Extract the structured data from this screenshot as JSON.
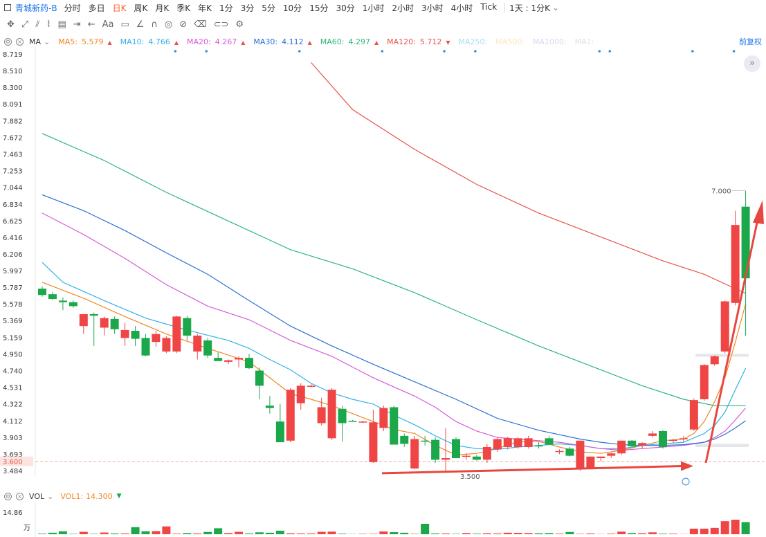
{
  "header": {
    "ticker": "青城新药-B",
    "timeframes": [
      "分时",
      "多日",
      "日K",
      "周K",
      "月K",
      "季K",
      "年K",
      "1分",
      "3分",
      "5分",
      "10分",
      "15分",
      "30分",
      "1小时",
      "2小时",
      "3小时",
      "4小时",
      "Tick"
    ],
    "active_timeframe": "日K",
    "custom_timeframe": "1天 : 1分K"
  },
  "toolbar": {
    "text_tool": "Aa"
  },
  "ma_bar": {
    "indicator": "MA",
    "items": [
      {
        "label": "MA5:",
        "value": "5.579",
        "trend": "▲",
        "color": "#f0861f"
      },
      {
        "label": "MA10:",
        "value": "4.766",
        "trend": "▲",
        "color": "#2fb1e8"
      },
      {
        "label": "MA20:",
        "value": "4.267",
        "trend": "▲",
        "color": "#d65ad8"
      },
      {
        "label": "MA30:",
        "value": "4.112",
        "trend": "▲",
        "color": "#2a6fd6"
      },
      {
        "label": "MA60:",
        "value": "4.297",
        "trend": "▲",
        "color": "#2bb67a"
      },
      {
        "label": "MA120:",
        "value": "5.712",
        "trend": "▼",
        "color": "#e8524d"
      },
      {
        "label": "MA250:",
        "value": "",
        "trend": "",
        "color": "#5ec8e8"
      },
      {
        "label": "MA500:",
        "value": "",
        "trend": "",
        "color": "#f6cf8a"
      },
      {
        "label": "MA1000:",
        "value": "",
        "trend": "",
        "color": "#b9b9e8"
      },
      {
        "label": "MA1:",
        "value": "",
        "trend": "",
        "color": "#c9c9c9"
      }
    ],
    "adjust": "前复权"
  },
  "vol_bar": {
    "indicator": "VOL",
    "item_label": "VOL1:",
    "item_value": "14.300",
    "trend": "▼"
  },
  "colors": {
    "up": "#f04545",
    "down": "#1aa84a",
    "arrow": "#e8473f"
  },
  "chart_data": {
    "type": "candlestick",
    "y_ticks": [
      "8.719",
      "8.510",
      "8.300",
      "8.091",
      "7.882",
      "7.672",
      "7.463",
      "7.253",
      "7.044",
      "6.834",
      "6.625",
      "6.416",
      "6.206",
      "5.997",
      "5.787",
      "5.578",
      "5.369",
      "5.159",
      "4.950",
      "4.740",
      "4.531",
      "4.322",
      "4.112",
      "3.903",
      "3.693",
      "3.484"
    ],
    "ylim": [
      3.484,
      8.719
    ],
    "current_price_label": "3.600",
    "annotations": [
      {
        "label": "7.000"
      },
      {
        "label": "3.500"
      }
    ],
    "candles": [
      {
        "o": 5.77,
        "h": 5.8,
        "l": 5.67,
        "c": 5.69
      },
      {
        "o": 5.7,
        "h": 5.73,
        "l": 5.63,
        "c": 5.64
      },
      {
        "o": 5.62,
        "h": 5.66,
        "l": 5.5,
        "c": 5.6
      },
      {
        "o": 5.6,
        "h": 5.62,
        "l": 5.53,
        "c": 5.55
      },
      {
        "o": 5.3,
        "h": 5.45,
        "l": 5.2,
        "c": 5.45
      },
      {
        "o": 5.45,
        "h": 5.47,
        "l": 5.05,
        "c": 5.43
      },
      {
        "o": 5.28,
        "h": 5.42,
        "l": 5.18,
        "c": 5.4
      },
      {
        "o": 5.39,
        "h": 5.42,
        "l": 5.2,
        "c": 5.26
      },
      {
        "o": 5.15,
        "h": 5.34,
        "l": 5.05,
        "c": 5.25
      },
      {
        "o": 5.24,
        "h": 5.3,
        "l": 5.05,
        "c": 5.14
      },
      {
        "o": 5.15,
        "h": 5.2,
        "l": 4.92,
        "c": 4.93
      },
      {
        "o": 5.1,
        "h": 5.24,
        "l": 5.04,
        "c": 5.2
      },
      {
        "o": 4.98,
        "h": 5.17,
        "l": 4.96,
        "c": 5.15
      },
      {
        "o": 4.98,
        "h": 5.43,
        "l": 4.96,
        "c": 5.42
      },
      {
        "o": 5.4,
        "h": 5.43,
        "l": 5.12,
        "c": 5.18
      },
      {
        "o": 4.98,
        "h": 5.2,
        "l": 4.88,
        "c": 5.18
      },
      {
        "o": 5.12,
        "h": 5.15,
        "l": 4.9,
        "c": 4.93
      },
      {
        "o": 4.9,
        "h": 4.97,
        "l": 4.86,
        "c": 4.86
      },
      {
        "o": 4.85,
        "h": 4.88,
        "l": 4.82,
        "c": 4.87
      },
      {
        "o": 4.88,
        "h": 4.92,
        "l": 4.78,
        "c": 4.9
      },
      {
        "o": 4.9,
        "h": 4.95,
        "l": 4.76,
        "c": 4.77
      },
      {
        "o": 4.74,
        "h": 4.78,
        "l": 4.38,
        "c": 4.55
      },
      {
        "o": 4.3,
        "h": 4.42,
        "l": 4.2,
        "c": 4.27
      },
      {
        "o": 4.1,
        "h": 4.32,
        "l": 3.88,
        "c": 3.84
      },
      {
        "o": 3.86,
        "h": 4.52,
        "l": 3.84,
        "c": 4.5
      },
      {
        "o": 4.33,
        "h": 4.58,
        "l": 4.25,
        "c": 4.55
      },
      {
        "o": 4.55,
        "h": 4.57,
        "l": 4.53,
        "c": 4.55
      },
      {
        "o": 4.08,
        "h": 4.4,
        "l": 4.05,
        "c": 4.28
      },
      {
        "o": 3.89,
        "h": 4.52,
        "l": 3.87,
        "c": 4.5
      },
      {
        "o": 4.26,
        "h": 4.3,
        "l": 3.85,
        "c": 4.08
      },
      {
        "o": 4.11,
        "h": 4.12,
        "l": 4.1,
        "c": 4.1
      },
      {
        "o": 4.1,
        "h": 4.11,
        "l": 4.08,
        "c": 4.1
      },
      {
        "o": 3.59,
        "h": 4.25,
        "l": 3.58,
        "c": 4.09
      },
      {
        "o": 4.02,
        "h": 4.3,
        "l": 3.98,
        "c": 4.27
      },
      {
        "o": 4.28,
        "h": 4.3,
        "l": 3.83,
        "c": 3.81
      },
      {
        "o": 3.92,
        "h": 3.95,
        "l": 3.78,
        "c": 3.82
      },
      {
        "o": 3.51,
        "h": 3.92,
        "l": 3.5,
        "c": 3.88
      },
      {
        "o": 3.86,
        "h": 3.92,
        "l": 3.8,
        "c": 3.85
      },
      {
        "o": 3.87,
        "h": 3.9,
        "l": 3.58,
        "c": 3.62
      },
      {
        "o": 3.62,
        "h": 4.02,
        "l": 3.48,
        "c": 3.64
      },
      {
        "o": 3.88,
        "h": 3.9,
        "l": 3.66,
        "c": 3.64
      },
      {
        "o": 3.66,
        "h": 3.7,
        "l": 3.62,
        "c": 3.67
      },
      {
        "o": 3.66,
        "h": 3.68,
        "l": 3.61,
        "c": 3.62
      },
      {
        "o": 3.62,
        "h": 3.82,
        "l": 3.58,
        "c": 3.78
      },
      {
        "o": 3.75,
        "h": 3.9,
        "l": 3.72,
        "c": 3.88
      },
      {
        "o": 3.78,
        "h": 3.91,
        "l": 3.75,
        "c": 3.89
      },
      {
        "o": 3.78,
        "h": 3.9,
        "l": 3.76,
        "c": 3.89
      },
      {
        "o": 3.78,
        "h": 3.92,
        "l": 3.76,
        "c": 3.89
      },
      {
        "o": 3.8,
        "h": 3.84,
        "l": 3.76,
        "c": 3.79
      },
      {
        "o": 3.89,
        "h": 3.92,
        "l": 3.82,
        "c": 3.81
      },
      {
        "o": 3.72,
        "h": 3.75,
        "l": 3.69,
        "c": 3.73
      },
      {
        "o": 3.76,
        "h": 3.78,
        "l": 3.66,
        "c": 3.67
      },
      {
        "o": 3.5,
        "h": 3.86,
        "l": 3.48,
        "c": 3.86
      },
      {
        "o": 3.52,
        "h": 3.66,
        "l": 3.5,
        "c": 3.66
      },
      {
        "o": 3.64,
        "h": 3.66,
        "l": 3.6,
        "c": 3.66
      },
      {
        "o": 3.67,
        "h": 3.71,
        "l": 3.64,
        "c": 3.7
      },
      {
        "o": 3.7,
        "h": 3.86,
        "l": 3.68,
        "c": 3.86
      },
      {
        "o": 3.86,
        "h": 3.87,
        "l": 3.78,
        "c": 3.79
      },
      {
        "o": 3.8,
        "h": 3.84,
        "l": 3.76,
        "c": 3.83
      },
      {
        "o": 3.92,
        "h": 3.98,
        "l": 3.9,
        "c": 3.95
      },
      {
        "o": 3.98,
        "h": 3.99,
        "l": 3.76,
        "c": 3.78
      },
      {
        "o": 3.86,
        "h": 3.88,
        "l": 3.83,
        "c": 3.87
      },
      {
        "o": 3.88,
        "h": 3.92,
        "l": 3.84,
        "c": 3.89
      },
      {
        "o": 4.0,
        "h": 4.39,
        "l": 3.98,
        "c": 4.37
      },
      {
        "o": 4.38,
        "h": 4.82,
        "l": 4.36,
        "c": 4.81
      },
      {
        "o": 4.82,
        "h": 4.93,
        "l": 4.8,
        "c": 4.92
      },
      {
        "o": 4.98,
        "h": 5.62,
        "l": 4.96,
        "c": 5.61
      },
      {
        "o": 5.59,
        "h": 6.75,
        "l": 5.56,
        "c": 6.57
      },
      {
        "o": 6.8,
        "h": 7.0,
        "l": 5.18,
        "c": 5.9
      }
    ],
    "series": [
      {
        "name": "MA5",
        "color": "#f0861f",
        "points": [
          [
            0,
            5.85
          ],
          [
            4,
            5.65
          ],
          [
            8,
            5.42
          ],
          [
            12,
            5.2
          ],
          [
            16,
            5.02
          ],
          [
            20,
            4.85
          ],
          [
            22,
            4.65
          ],
          [
            24,
            4.45
          ],
          [
            26,
            4.38
          ],
          [
            28,
            4.3
          ],
          [
            30,
            4.2
          ],
          [
            32,
            4.1
          ],
          [
            34,
            4.0
          ],
          [
            36,
            3.95
          ],
          [
            38,
            3.8
          ],
          [
            40,
            3.68
          ],
          [
            42,
            3.7
          ],
          [
            44,
            3.76
          ],
          [
            46,
            3.85
          ],
          [
            48,
            3.85
          ],
          [
            50,
            3.78
          ],
          [
            52,
            3.72
          ],
          [
            54,
            3.7
          ],
          [
            56,
            3.74
          ],
          [
            58,
            3.8
          ],
          [
            60,
            3.86
          ],
          [
            62,
            3.88
          ],
          [
            63,
            3.95
          ],
          [
            64,
            4.1
          ],
          [
            65,
            4.35
          ],
          [
            66,
            4.65
          ],
          [
            67,
            5.1
          ],
          [
            68,
            5.58
          ]
        ]
      },
      {
        "name": "MA10",
        "color": "#2fb1e8",
        "points": [
          [
            0,
            6.1
          ],
          [
            2,
            5.85
          ],
          [
            6,
            5.62
          ],
          [
            10,
            5.4
          ],
          [
            14,
            5.25
          ],
          [
            18,
            5.12
          ],
          [
            20,
            5.02
          ],
          [
            22,
            4.88
          ],
          [
            24,
            4.75
          ],
          [
            26,
            4.58
          ],
          [
            28,
            4.46
          ],
          [
            30,
            4.38
          ],
          [
            32,
            4.32
          ],
          [
            34,
            4.18
          ],
          [
            36,
            4.06
          ],
          [
            38,
            3.92
          ],
          [
            40,
            3.8
          ],
          [
            42,
            3.76
          ],
          [
            44,
            3.75
          ],
          [
            46,
            3.78
          ],
          [
            48,
            3.8
          ],
          [
            50,
            3.82
          ],
          [
            52,
            3.8
          ],
          [
            54,
            3.76
          ],
          [
            56,
            3.76
          ],
          [
            58,
            3.8
          ],
          [
            60,
            3.82
          ],
          [
            62,
            3.84
          ],
          [
            64,
            3.95
          ],
          [
            65,
            4.05
          ],
          [
            66,
            4.22
          ],
          [
            67,
            4.5
          ],
          [
            68,
            4.77
          ]
        ]
      },
      {
        "name": "MA20",
        "color": "#d65ad8",
        "points": [
          [
            0,
            6.72
          ],
          [
            4,
            6.45
          ],
          [
            8,
            6.15
          ],
          [
            12,
            5.82
          ],
          [
            16,
            5.55
          ],
          [
            20,
            5.38
          ],
          [
            24,
            5.12
          ],
          [
            28,
            4.92
          ],
          [
            32,
            4.65
          ],
          [
            36,
            4.42
          ],
          [
            38,
            4.28
          ],
          [
            40,
            4.1
          ],
          [
            42,
            3.98
          ],
          [
            44,
            3.9
          ],
          [
            46,
            3.88
          ],
          [
            48,
            3.86
          ],
          [
            50,
            3.84
          ],
          [
            52,
            3.8
          ],
          [
            54,
            3.76
          ],
          [
            56,
            3.74
          ],
          [
            58,
            3.76
          ],
          [
            60,
            3.78
          ],
          [
            62,
            3.8
          ],
          [
            64,
            3.84
          ],
          [
            65,
            3.9
          ],
          [
            66,
            3.98
          ],
          [
            67,
            4.12
          ],
          [
            68,
            4.27
          ]
        ]
      },
      {
        "name": "MA30",
        "color": "#2a6fd6",
        "points": [
          [
            0,
            6.95
          ],
          [
            4,
            6.75
          ],
          [
            8,
            6.5
          ],
          [
            12,
            6.22
          ],
          [
            16,
            5.95
          ],
          [
            20,
            5.62
          ],
          [
            24,
            5.3
          ],
          [
            28,
            5.05
          ],
          [
            32,
            4.82
          ],
          [
            36,
            4.6
          ],
          [
            40,
            4.38
          ],
          [
            44,
            4.14
          ],
          [
            48,
            3.99
          ],
          [
            52,
            3.88
          ],
          [
            54,
            3.84
          ],
          [
            56,
            3.81
          ],
          [
            58,
            3.8
          ],
          [
            60,
            3.8
          ],
          [
            62,
            3.81
          ],
          [
            64,
            3.84
          ],
          [
            65,
            3.88
          ],
          [
            66,
            3.94
          ],
          [
            67,
            4.02
          ],
          [
            68,
            4.11
          ]
        ]
      },
      {
        "name": "MA60",
        "color": "#2bb67a",
        "points": [
          [
            0,
            7.72
          ],
          [
            6,
            7.38
          ],
          [
            12,
            6.98
          ],
          [
            18,
            6.62
          ],
          [
            24,
            6.26
          ],
          [
            30,
            6.02
          ],
          [
            36,
            5.72
          ],
          [
            42,
            5.38
          ],
          [
            48,
            5.05
          ],
          [
            54,
            4.75
          ],
          [
            58,
            4.55
          ],
          [
            62,
            4.38
          ],
          [
            65,
            4.3
          ],
          [
            68,
            4.3
          ]
        ]
      },
      {
        "name": "MA120",
        "color": "#e8524d",
        "points": [
          [
            26,
            8.61
          ],
          [
            30,
            8.02
          ],
          [
            36,
            7.52
          ],
          [
            42,
            7.08
          ],
          [
            48,
            6.72
          ],
          [
            54,
            6.42
          ],
          [
            60,
            6.12
          ],
          [
            64,
            5.95
          ],
          [
            68,
            5.71
          ]
        ]
      }
    ],
    "volume": {
      "max_label": "14.86",
      "unit_label": "万",
      "values": [
        0.3,
        0.8,
        1.6,
        0.2,
        1.3,
        0.2,
        0.9,
        0.4,
        0.4,
        3.8,
        1.6,
        1.7,
        4.2,
        0.3,
        0.6,
        0.4,
        1.2,
        3.2,
        0.6,
        1.3,
        0.4,
        1.0,
        0.8,
        1.9,
        0.5,
        0.4,
        0.4,
        1.3,
        1.4,
        0.3,
        0.1,
        0.2,
        0.2,
        1.5,
        1.1,
        0.8,
        0.2,
        5.6,
        0.4,
        0.4,
        0.2,
        0.6,
        0.3,
        0.5,
        0.4,
        0.8,
        0.7,
        0.6,
        0.5,
        0.6,
        0.3,
        1.2,
        0.2,
        0.4,
        0.1,
        0.3,
        1.4,
        0.6,
        0.5,
        1.0,
        0.3,
        0.3,
        0.1,
        3.0,
        3.0,
        3.4,
        7.0,
        7.8,
        6.5
      ]
    }
  }
}
